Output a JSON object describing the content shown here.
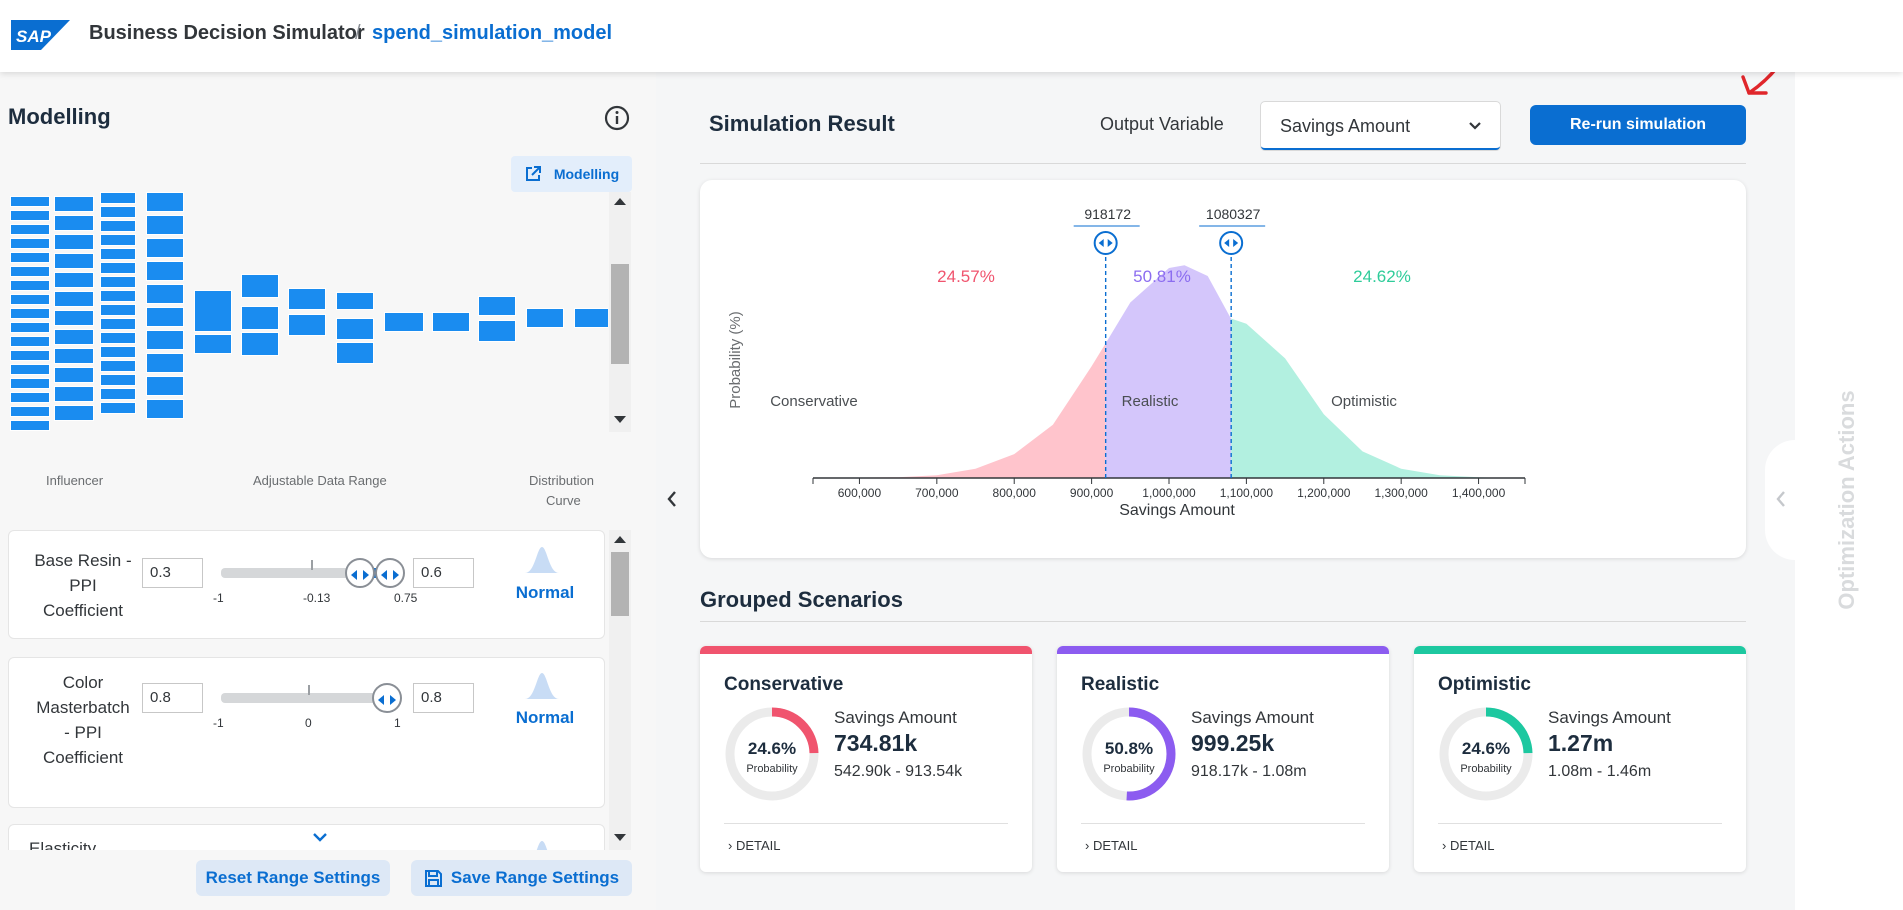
{
  "header": {
    "logo_text": "SAP",
    "app_title": "Business Decision Simulator",
    "separator": "/",
    "model_name": "spend_simulation_model"
  },
  "left": {
    "title": "Modelling",
    "modelling_button": "Modelling",
    "columns": {
      "influencer": "Influencer",
      "range": "Adjustable Data Range",
      "curve_line1": "Distribution",
      "curve_line2": "Curve"
    },
    "params": [
      {
        "name_lines": [
          "Base Resin -",
          "PPI",
          "Coefficient"
        ],
        "min_value": "0.3",
        "max_value": "0.6",
        "ticks": [
          "-1",
          "-0.13",
          "0.75"
        ],
        "distribution": "Normal"
      },
      {
        "name_lines": [
          "Color",
          "Masterbatch",
          "- PPI",
          "Coefficient"
        ],
        "min_value": "0.8",
        "max_value": "0.8",
        "ticks": [
          "-1",
          "0",
          "1"
        ],
        "distribution": "Normal"
      },
      {
        "name_lines": [
          "Elasticity"
        ]
      }
    ],
    "reset_button": "Reset Range Settings",
    "save_button": "Save Range Settings"
  },
  "result": {
    "title": "Simulation Result",
    "output_label": "Output Variable",
    "output_value": "Savings Amount",
    "rerun_button": "Re-run simulation"
  },
  "chart_data": {
    "type": "area",
    "title": "",
    "xlabel": "Savings Amount",
    "ylabel": "Probability (%)",
    "xlim": [
      540000,
      1460000
    ],
    "x_ticks": [
      "600,000",
      "700,000",
      "800,000",
      "900,000",
      "1,000,000",
      "1,100,000",
      "1,200,000",
      "1,300,000",
      "1,400,000"
    ],
    "x_tick_values": [
      600000,
      700000,
      800000,
      900000,
      1000000,
      1100000,
      1200000,
      1300000,
      1400000
    ],
    "thresholds": [
      918172,
      1080327
    ],
    "threshold_labels": [
      "918172",
      "1080327"
    ],
    "regions": [
      {
        "name": "Conservative",
        "percent": "24.57%",
        "color": "#ffc4cc",
        "text_color": "#f0546e"
      },
      {
        "name": "Realistic",
        "percent": "50.81%",
        "color": "#d4c6fb",
        "text_color": "#8c6df0"
      },
      {
        "name": "Optimistic",
        "percent": "24.62%",
        "color": "#b2f0e0",
        "text_color": "#2fcc9a"
      }
    ],
    "curve_x": [
      545000,
      650000,
      700000,
      750000,
      800000,
      850000,
      900000,
      950000,
      1000000,
      1020000,
      1050000,
      1080000,
      1100000,
      1150000,
      1200000,
      1250000,
      1300000,
      1350000,
      1400000,
      1440000
    ],
    "curve_y": [
      0,
      0.3,
      1,
      3.5,
      9,
      20,
      42,
      66,
      79,
      80,
      76,
      60,
      58,
      45,
      24,
      10,
      3.5,
      1,
      0.3,
      0
    ]
  },
  "grouped": {
    "title": "Grouped Scenarios",
    "scenarios": [
      {
        "name": "Conservative",
        "color": "#f0546e",
        "percent": "24.6%",
        "fraction": 0.246,
        "prob_label": "Probability",
        "metric": "Savings Amount",
        "value": "734.81k",
        "range": "542.90k - 913.54k",
        "detail": "DETAIL"
      },
      {
        "name": "Realistic",
        "color": "#8c5cf0",
        "percent": "50.8%",
        "fraction": 0.508,
        "prob_label": "Probability",
        "metric": "Savings Amount",
        "value": "999.25k",
        "range": "918.17k - 1.08m",
        "detail": "DETAIL"
      },
      {
        "name": "Optimistic",
        "color": "#1dc8a0",
        "percent": "24.6%",
        "fraction": 0.246,
        "prob_label": "Probability",
        "metric": "Savings Amount",
        "value": "1.27m",
        "range": "1.08m - 1.46m",
        "detail": "DETAIL"
      }
    ]
  },
  "side_panel": {
    "label": "Optimization Actions"
  }
}
